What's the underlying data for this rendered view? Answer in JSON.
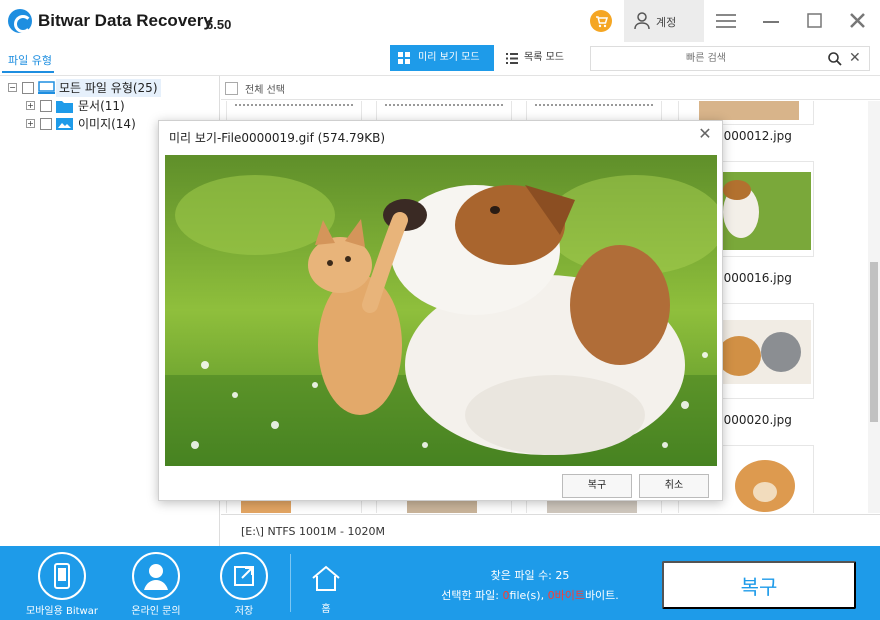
{
  "title_bar": {
    "app_name": "Bitwar Data Recovery",
    "version": "6.50",
    "account_label": "계정"
  },
  "toolbar": {
    "file_type_tab": "파일 유형",
    "preview_mode": "미리 보기 모드",
    "list_mode": "목록 모드",
    "search_placeholder": "빠른 검색"
  },
  "tree": {
    "root": {
      "label": "모든 파일 유형(25)"
    },
    "items": [
      {
        "label": "문서(11)"
      },
      {
        "label": "이미지(14)"
      }
    ]
  },
  "file_area": {
    "select_all": "전체 선택",
    "files": [
      {
        "name": "0000012.jpg"
      },
      {
        "name": "0000016.jpg"
      },
      {
        "name": "0000020.jpg"
      }
    ],
    "status": "[E:\\] NTFS 1001M - 1020M"
  },
  "preview_dialog": {
    "title": "미리 보기-File0000019.gif (574.79KB)",
    "recover_button": "복구",
    "cancel_button": "취소"
  },
  "bottom_bar": {
    "mobile_label": "모바일용 Bitwar",
    "online_help_label": "온라인 문의",
    "save_label": "저장",
    "home_label": "홈",
    "found_files": "찾은 파일 수: 25",
    "selected_prefix": "선택한 파일: ",
    "selected_count": "0",
    "selected_mid": "file(s), ",
    "selected_bytes": "0바이트",
    "selected_suffix": "바이트.",
    "recover_button": "복구"
  },
  "colors": {
    "accent": "#1e9be9",
    "highlight_red": "#ff3b30",
    "cart": "#f5a623"
  }
}
